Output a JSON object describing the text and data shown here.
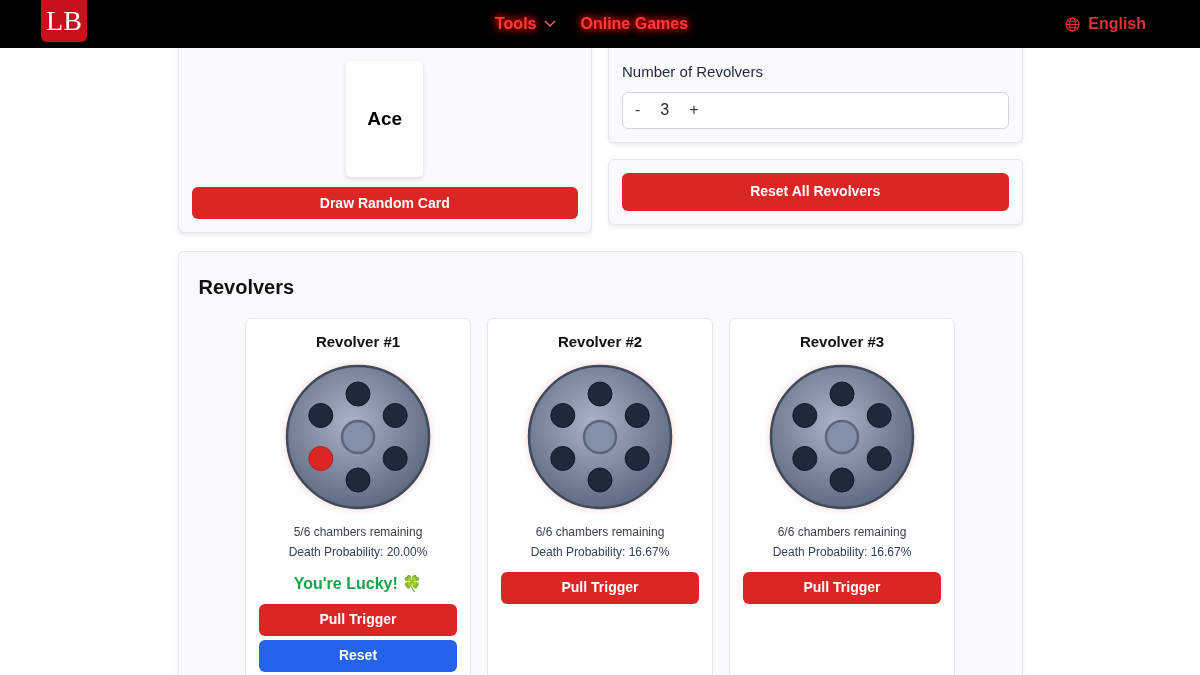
{
  "header": {
    "logo": "LB",
    "nav": [
      {
        "label": "Tools",
        "dropdown": true
      },
      {
        "label": "Online Games",
        "dropdown": false
      }
    ],
    "language": "English"
  },
  "card_panel": {
    "card": "Ace",
    "button": "Draw Random Card"
  },
  "settings": {
    "label": "Number of Revolvers",
    "minus": "-",
    "value": "3",
    "plus": "+"
  },
  "reset_all": "Reset All Revolvers",
  "revolvers_section": {
    "title": "Revolvers",
    "revolvers": [
      {
        "title": "Revolver #1",
        "chambers": [
          {
            "fired": false
          },
          {
            "fired": false
          },
          {
            "fired": false
          },
          {
            "fired": false
          },
          {
            "fired": true
          },
          {
            "fired": false
          }
        ],
        "remaining": "5/6 chambers remaining",
        "probability": "Death Probability: 20.00%",
        "result": "You're Lucky! 🍀",
        "buttons": [
          {
            "label": "Pull Trigger",
            "kind": "fire"
          },
          {
            "label": "Reset",
            "kind": "reset"
          }
        ]
      },
      {
        "title": "Revolver #2",
        "chambers": [
          {
            "fired": false
          },
          {
            "fired": false
          },
          {
            "fired": false
          },
          {
            "fired": false
          },
          {
            "fired": false
          },
          {
            "fired": false
          }
        ],
        "remaining": "6/6 chambers remaining",
        "probability": "Death Probability: 16.67%",
        "buttons": [
          {
            "label": "Pull Trigger",
            "kind": "fire"
          }
        ]
      },
      {
        "title": "Revolver #3",
        "chambers": [
          {
            "fired": false
          },
          {
            "fired": false
          },
          {
            "fired": false
          },
          {
            "fired": false
          },
          {
            "fired": false
          },
          {
            "fired": false
          }
        ],
        "remaining": "6/6 chambers remaining",
        "probability": "Death Probability: 16.67%",
        "buttons": [
          {
            "label": "Pull Trigger",
            "kind": "fire"
          }
        ]
      }
    ]
  }
}
